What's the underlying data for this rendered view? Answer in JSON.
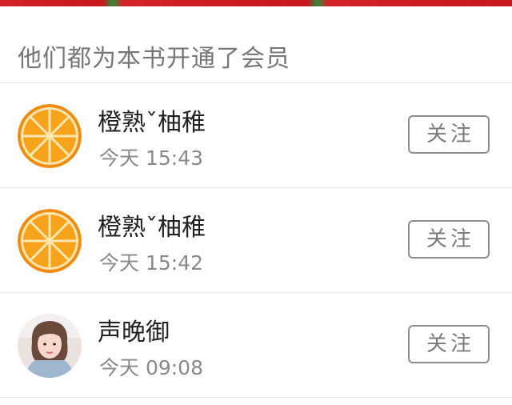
{
  "section": {
    "title": "他们都为本书开通了会员"
  },
  "members": [
    {
      "name": "橙熟ˇ柚稚",
      "time": "今天 15:43",
      "follow_label": "关注",
      "avatar_icon": "orange-slice-avatar"
    },
    {
      "name": "橙熟ˇ柚稚",
      "time": "今天 15:42",
      "follow_label": "关注",
      "avatar_icon": "orange-slice-avatar"
    },
    {
      "name": "声晚御",
      "time": "今天 09:08",
      "follow_label": "关注",
      "avatar_icon": "user-photo-avatar"
    }
  ],
  "colors": {
    "top_strip": "#c8161e",
    "orange": "#f7941d",
    "button_border": "#8f8f8f"
  }
}
